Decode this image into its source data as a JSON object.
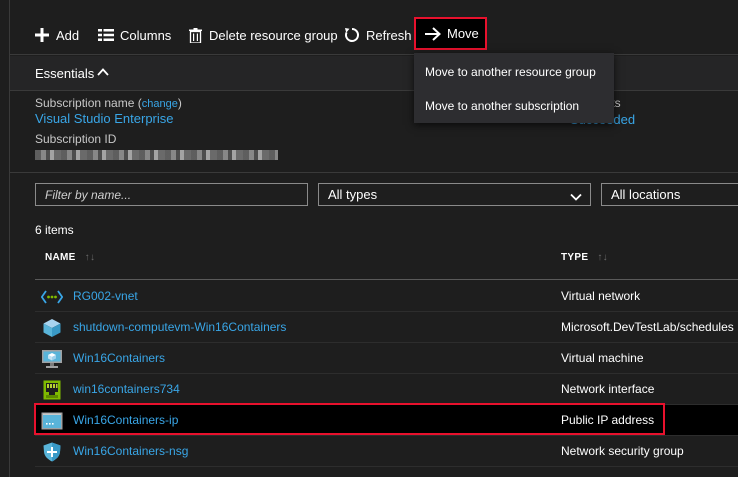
{
  "toolbar": {
    "add_label": "Add",
    "columns_label": "Columns",
    "delete_label": "Delete resource group",
    "refresh_label": "Refresh",
    "move_label": "Move"
  },
  "move_menu": {
    "items": [
      "Move to another resource group",
      "Move to another subscription"
    ]
  },
  "essentials": {
    "title": "Essentials",
    "subscription_name_label": "Subscription name",
    "change_link": "change",
    "subscription_name": "Visual Studio Enterprise",
    "subscription_id_label": "Subscription ID",
    "deployments_label": "ents",
    "deployments_value": "Succeeded"
  },
  "filters": {
    "name_placeholder": "Filter by name...",
    "types_value": "All types",
    "locations_value": "All locations"
  },
  "items_count": "6 items",
  "table": {
    "columns": [
      "NAME",
      "TYPE"
    ],
    "rows": [
      {
        "name": "RG002-vnet",
        "type": "Virtual network",
        "icon": "virtual-network-icon"
      },
      {
        "name": "shutdown-computevm-Win16Containers",
        "type": "Microsoft.DevTestLab/schedules",
        "icon": "schedule-cube-icon"
      },
      {
        "name": "Win16Containers",
        "type": "Virtual machine",
        "icon": "virtual-machine-icon"
      },
      {
        "name": "win16containers734",
        "type": "Network interface",
        "icon": "network-interface-icon"
      },
      {
        "name": "Win16Containers-ip",
        "type": "Public IP address",
        "icon": "public-ip-icon"
      },
      {
        "name": "Win16Containers-nsg",
        "type": "Network security group",
        "icon": "shield-icon"
      }
    ]
  },
  "colors": {
    "background": "#1e1e1e",
    "link": "#39a6e7",
    "highlight": "#e8112d"
  }
}
